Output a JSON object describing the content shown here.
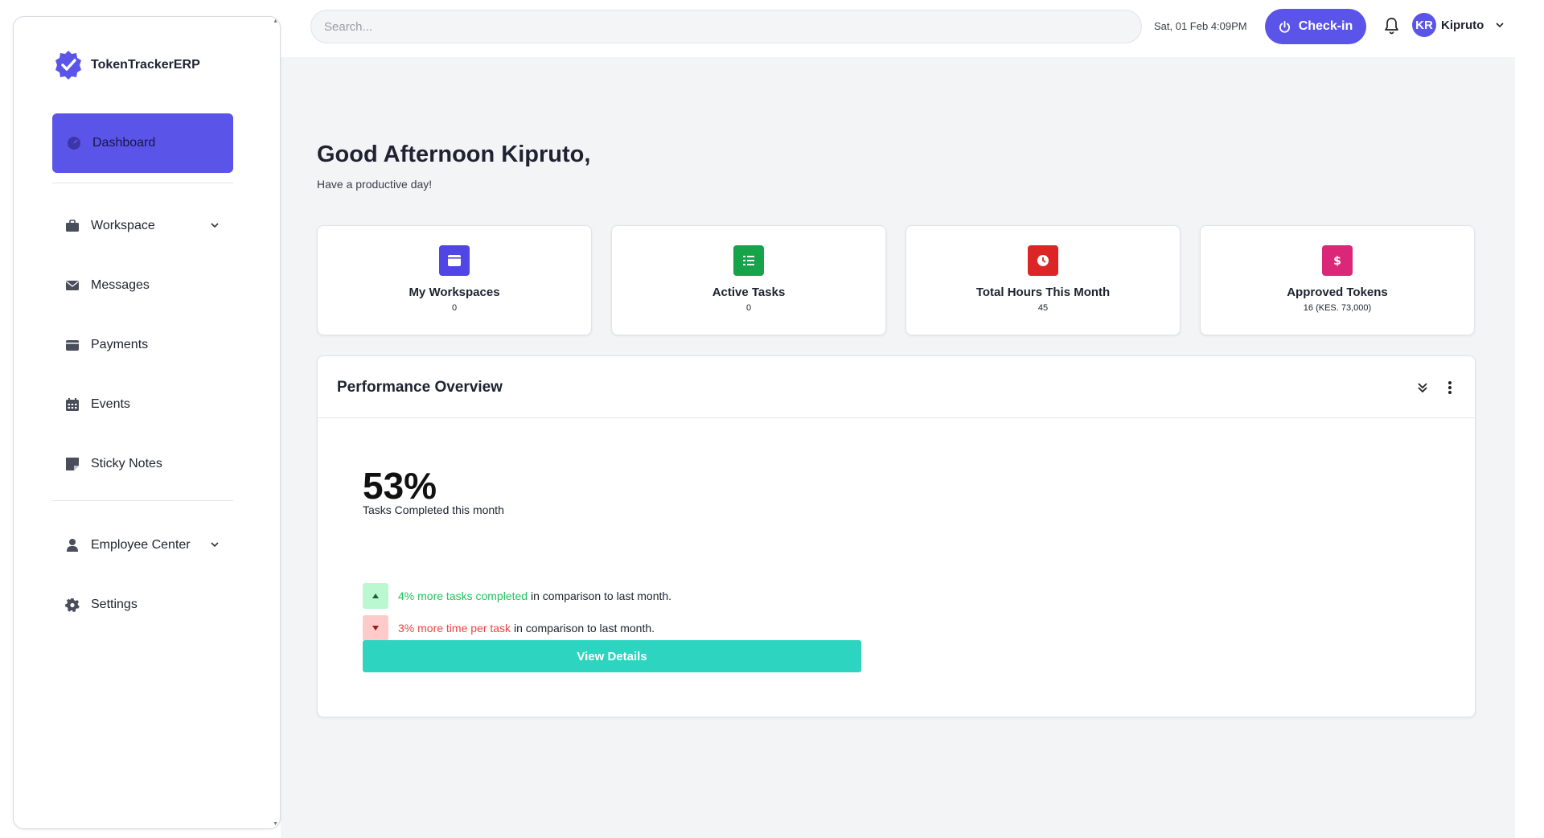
{
  "brand": {
    "name": "TokenTrackerERP"
  },
  "sidebar": {
    "active": {
      "label": "Dashboard"
    },
    "items": [
      {
        "label": "Workspace",
        "icon": "briefcase-icon",
        "has_children": true
      },
      {
        "label": "Messages",
        "icon": "envelope-icon",
        "has_children": false
      },
      {
        "label": "Payments",
        "icon": "wallet-icon",
        "has_children": false
      },
      {
        "label": "Events",
        "icon": "calendar-icon",
        "has_children": false
      },
      {
        "label": "Sticky Notes",
        "icon": "sticky-note-icon",
        "has_children": false
      },
      {
        "label": "Employee Center",
        "icon": "user-tie-icon",
        "has_children": true
      },
      {
        "label": "Settings",
        "icon": "gear-icon",
        "has_children": false
      }
    ]
  },
  "topbar": {
    "search_placeholder": "Search...",
    "datetime": "Sat, 01 Feb 4:09PM",
    "checkin_label": "Check-in",
    "user": {
      "initials": "KR",
      "name": "Kipruto"
    }
  },
  "greeting": {
    "title": "Good Afternoon Kipruto,",
    "subtitle": "Have a productive day!"
  },
  "cards": [
    {
      "title": "My Workspaces",
      "value": "0",
      "color": "#4f46e5",
      "icon": "folder-icon"
    },
    {
      "title": "Active Tasks",
      "value": "0",
      "color": "#16a34a",
      "icon": "task-list-icon"
    },
    {
      "title": "Total Hours This Month",
      "value": "45",
      "color": "#dc2626",
      "icon": "clock-icon"
    },
    {
      "title": "Approved Tokens",
      "value": "16 (KES. 73,000)",
      "color": "#db2777",
      "icon": "dollar-icon"
    }
  ],
  "performance": {
    "title": "Performance Overview",
    "percent": "53%",
    "percent_caption": "Tasks Completed this month",
    "trends": [
      {
        "highlight": "4% more tasks completed",
        "rest": " in comparison to last month.",
        "direction": "up",
        "color": "#22c55e",
        "bg": "#bbf7d0"
      },
      {
        "highlight": "3% more time per task",
        "rest": " in comparison to last month.",
        "direction": "down",
        "color": "#ef4444",
        "bg": "#fecaca"
      }
    ],
    "button_label": "View Details"
  },
  "colors": {
    "accent": "#5b54e8",
    "teal": "#2dd4bf"
  }
}
